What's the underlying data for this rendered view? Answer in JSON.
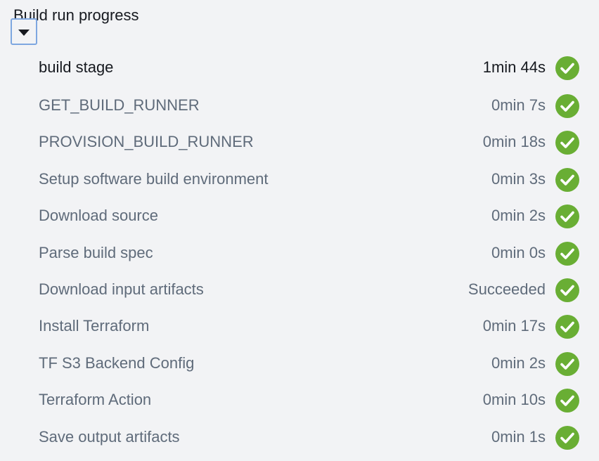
{
  "title": "Build run progress",
  "stage": {
    "label": "build stage",
    "duration": "1min 44s",
    "status": "success",
    "expanded": true
  },
  "steps": [
    {
      "label": "GET_BUILD_RUNNER",
      "duration": "0min 7s",
      "status": "success"
    },
    {
      "label": "PROVISION_BUILD_RUNNER",
      "duration": "0min 18s",
      "status": "success"
    },
    {
      "label": "Setup software build environment",
      "duration": "0min 3s",
      "status": "success"
    },
    {
      "label": "Download source",
      "duration": "0min 2s",
      "status": "success"
    },
    {
      "label": "Parse build spec",
      "duration": "0min 0s",
      "status": "success"
    },
    {
      "label": "Download input artifacts",
      "duration": "Succeeded",
      "status": "success"
    },
    {
      "label": "Install Terraform",
      "duration": "0min 17s",
      "status": "success"
    },
    {
      "label": "TF S3 Backend Config",
      "duration": "0min 2s",
      "status": "success"
    },
    {
      "label": "Terraform Action",
      "duration": "0min 10s",
      "status": "success"
    },
    {
      "label": "Save output artifacts",
      "duration": "0min 1s",
      "status": "success"
    }
  ],
  "colors": {
    "success": "#69ae34",
    "text_primary": "#16191f",
    "text_secondary": "#5f6b7a",
    "background": "#f2f3f5",
    "focus_ring": "#7ea7e0"
  },
  "icons": {
    "success": "check-circle-icon",
    "toggle": "caret-down-icon"
  }
}
